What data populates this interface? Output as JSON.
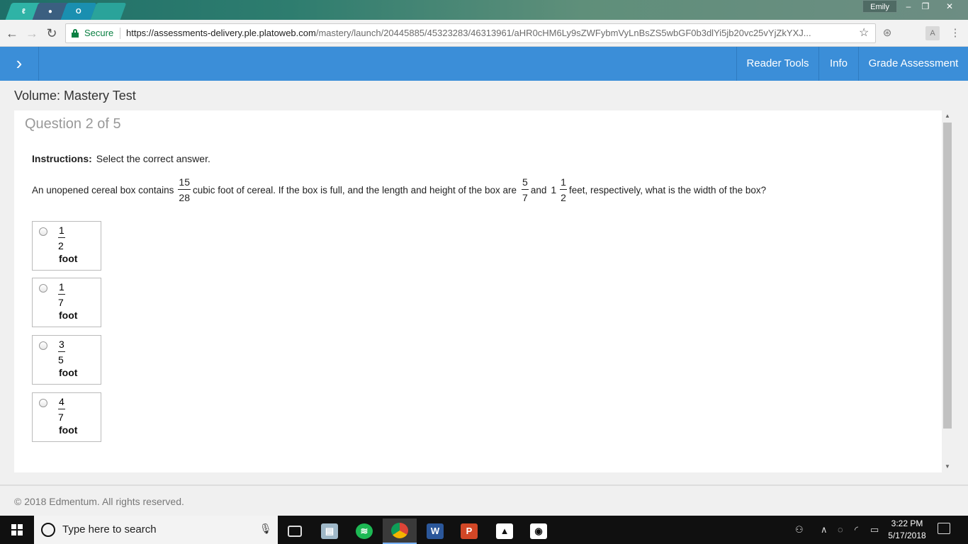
{
  "browser": {
    "user_name": "Emily",
    "secure_label": "Secure",
    "url_host": "https://assessments-delivery.ple.platoweb.com",
    "url_path": "/mastery/launch/20445885/45323283/46313961/aHR0cHM6Ly9sZWFybmVyLnBsZS5wbGF0b3dlYi5jb20vc25vYjZkYXJ..."
  },
  "header": {
    "reader_tools": "Reader Tools",
    "info": "Info",
    "grade_assessment": "Grade Assessment",
    "accent": "#3b8ed8"
  },
  "page": {
    "title": "Volume: Mastery Test",
    "question_counter": "Question 2 of 5"
  },
  "question": {
    "instructions_label": "Instructions:",
    "instructions_text": "Select the correct answer.",
    "part1": "An unopened cereal box contains",
    "frac1_num": "15",
    "frac1_den": "28",
    "part2": "cubic foot of cereal. If the box is full, and the length and height of the box are",
    "frac2_num": "5",
    "frac2_den": "7",
    "part3": "and",
    "mixed_whole": "1",
    "frac3_num": "1",
    "frac3_den": "2",
    "part4": "feet, respectively, what is the width of the box?"
  },
  "options": [
    {
      "num": "1",
      "den": "2",
      "unit": "foot"
    },
    {
      "num": "1",
      "den": "7",
      "unit": "foot"
    },
    {
      "num": "3",
      "den": "5",
      "unit": "foot"
    },
    {
      "num": "4",
      "den": "7",
      "unit": "foot"
    }
  ],
  "footer": {
    "copyright": "© 2018 Edmentum. All rights reserved."
  },
  "taskbar": {
    "search_placeholder": "Type here to search",
    "time": "3:22 PM",
    "date": "5/17/2018"
  }
}
